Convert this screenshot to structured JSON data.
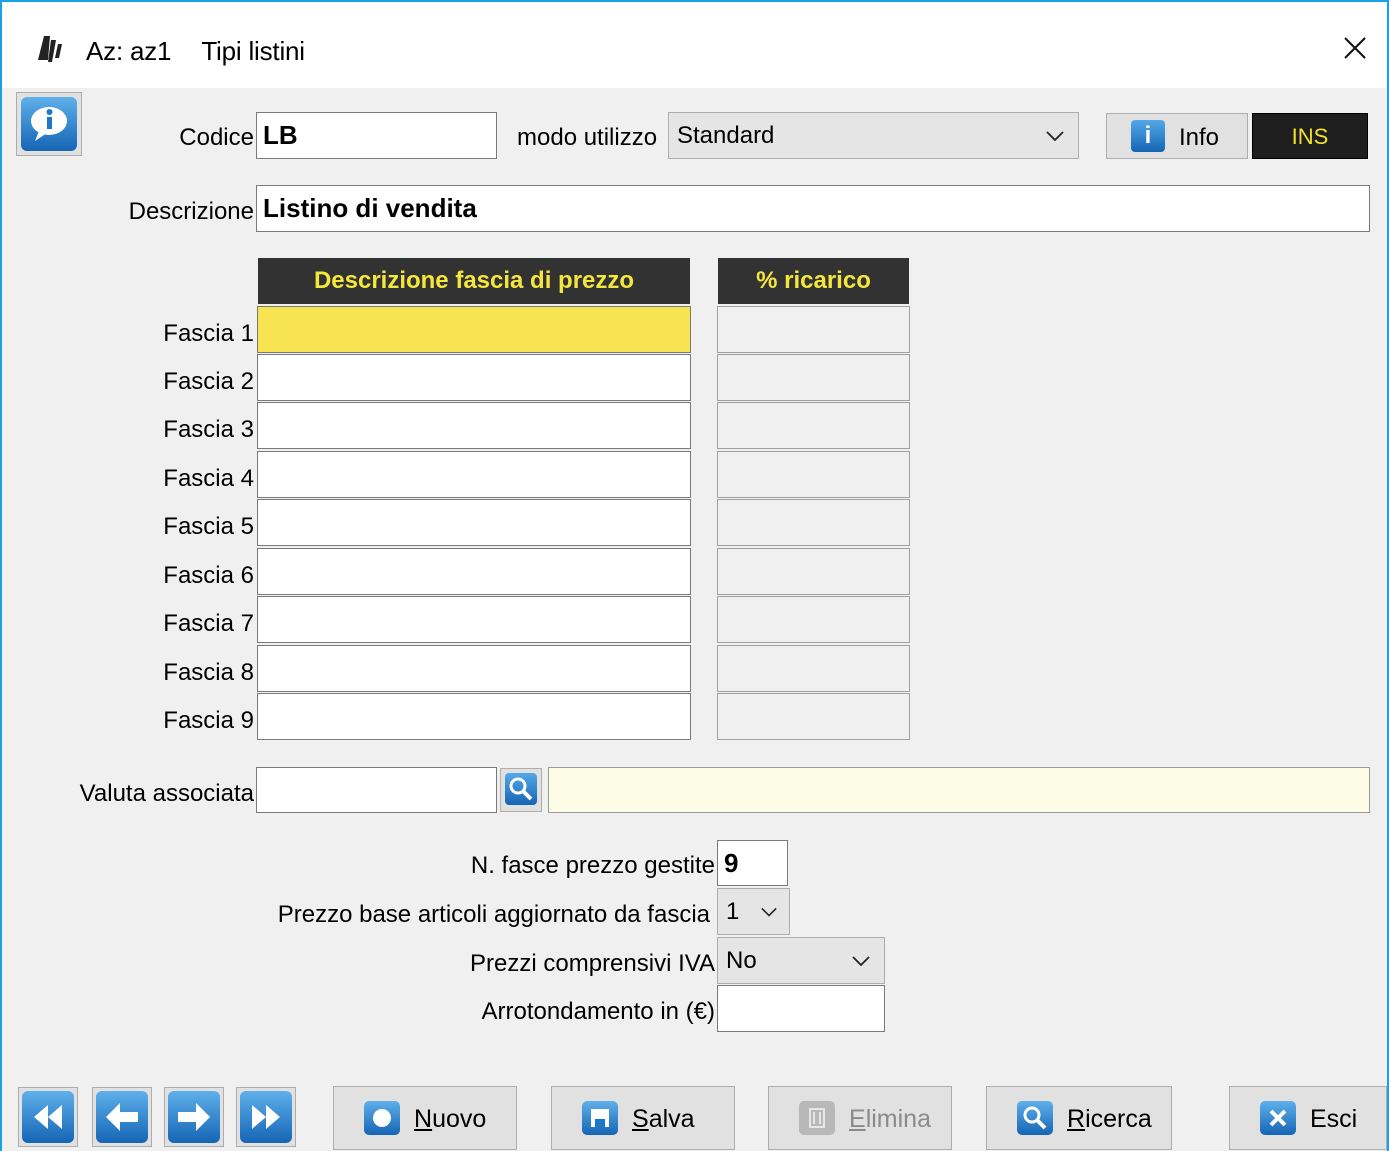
{
  "window": {
    "app_icon": "app-logo-icon",
    "company": "Az: az1",
    "title": "Tipi listini",
    "close_icon": "close-icon"
  },
  "header": {
    "codice_label": "Codice",
    "codice_value": "LB",
    "modo_label": "modo utilizzo",
    "modo_value": "Standard",
    "info_label": "Info",
    "mode_badge": "INS",
    "descrizione_label": "Descrizione",
    "descrizione_value": "Listino di vendita"
  },
  "table": {
    "col1_header": "Descrizione fascia di prezzo",
    "col2_header": "% ricarico",
    "rows": [
      {
        "label": "Fascia 1",
        "descr": "",
        "ricarico": ""
      },
      {
        "label": "Fascia 2",
        "descr": "",
        "ricarico": ""
      },
      {
        "label": "Fascia 3",
        "descr": "",
        "ricarico": ""
      },
      {
        "label": "Fascia 4",
        "descr": "",
        "ricarico": ""
      },
      {
        "label": "Fascia 5",
        "descr": "",
        "ricarico": ""
      },
      {
        "label": "Fascia 6",
        "descr": "",
        "ricarico": ""
      },
      {
        "label": "Fascia 7",
        "descr": "",
        "ricarico": ""
      },
      {
        "label": "Fascia 8",
        "descr": "",
        "ricarico": ""
      },
      {
        "label": "Fascia 9",
        "descr": "",
        "ricarico": ""
      }
    ]
  },
  "valuta": {
    "label": "Valuta associata",
    "code": "",
    "description": ""
  },
  "settings": {
    "n_fasce_label": "N. fasce prezzo gestite",
    "n_fasce_value": "9",
    "prezzo_base_label": "Prezzo base articoli aggiornato da fascia",
    "prezzo_base_value": "1",
    "iva_label": "Prezzi comprensivi IVA",
    "iva_value": "No",
    "arrot_label": "Arrotondamento in (€)",
    "arrot_value": ""
  },
  "toolbar": {
    "nuovo_u": "N",
    "nuovo_rest": "uovo",
    "salva_u": "S",
    "salva_rest": "alva",
    "elimina_u": "E",
    "elimina_rest": "limina",
    "ricerca_u": "R",
    "ricerca_rest": "icerca",
    "esci": "Esci"
  },
  "colors": {
    "accent_border": "#1aa0e8",
    "header_bg": "#323232",
    "header_fg": "#f5e63c",
    "selected_cell": "#f8e452",
    "valuta_desc_bg": "#fdfde6"
  }
}
